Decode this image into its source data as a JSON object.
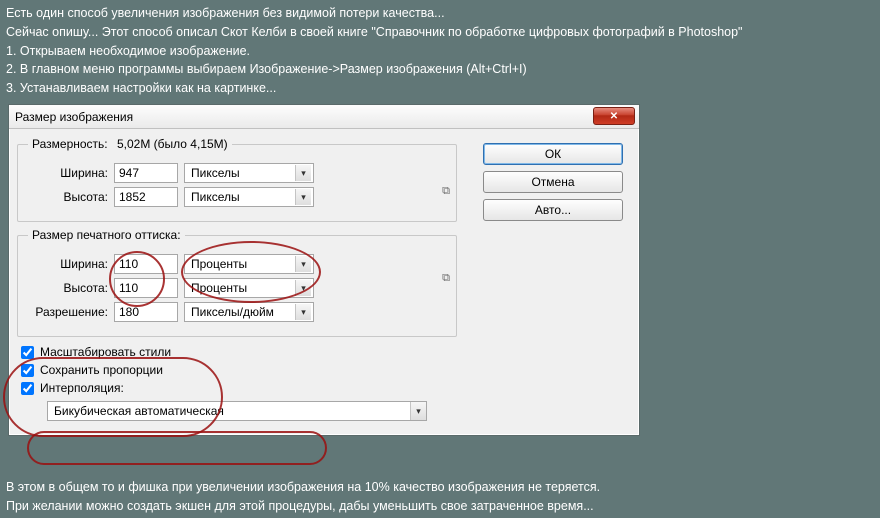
{
  "bg": {
    "l1": "Есть один способ увеличения изображения без видимой потери качества...",
    "l2": "Сейчас опишу... Этот способ описал Скот Келби в своей книге \"Справочник по обработке цифровых фотографий в Photoshop\"",
    "l3": "1. Открываем необходимое изображение.",
    "l4": "2. В главном меню программы выбираем Изображение->Размер изображения (Alt+Ctrl+I)",
    "l5": "3. Устанавливаем настройки как на картинке...",
    "b1": "В этом в общем то и фишка при увеличении изображения на 10% качество изображения не теряется.",
    "b2": "При желании можно создать экшен для этой процедуры, дабы уменьшить свое затраченное время..."
  },
  "dialog": {
    "title": "Размер изображения",
    "dim": {
      "legend": "Размерность:",
      "value": "5,02M (было 4,15M)",
      "width_label": "Ширина:",
      "width_val": "947",
      "width_unit": "Пикселы",
      "height_label": "Высота:",
      "height_val": "1852",
      "height_unit": "Пикселы"
    },
    "doc": {
      "legend": "Размер печатного оттиска:",
      "width_label": "Ширина:",
      "width_val": "110",
      "width_unit": "Проценты",
      "height_label": "Высота:",
      "height_val": "110",
      "height_unit": "Проценты",
      "res_label": "Разрешение:",
      "res_val": "180",
      "res_unit": "Пикселы/дюйм"
    },
    "checks": {
      "scale": "Масштабировать стили",
      "constrain": "Сохранить пропорции",
      "interp_label": "Интерполяция:",
      "interp_value": "Бикубическая автоматическая"
    },
    "buttons": {
      "ok": "ОК",
      "cancel": "Отмена",
      "auto": "Авто..."
    }
  }
}
